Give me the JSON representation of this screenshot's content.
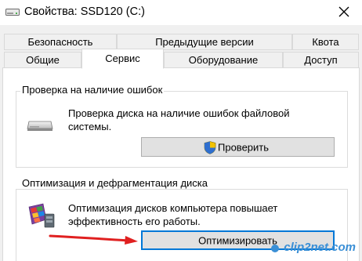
{
  "window": {
    "title": "Свойства: SSD120 (C:)",
    "title_icon": "drive-icon",
    "close_icon": "close-icon"
  },
  "tabs": {
    "row_top": [
      {
        "label": "Безопасность"
      },
      {
        "label": "Предыдущие версии"
      },
      {
        "label": "Квота"
      }
    ],
    "row_bottom": [
      {
        "label": "Общие"
      },
      {
        "label": "Сервис",
        "active": true
      },
      {
        "label": "Оборудование"
      },
      {
        "label": "Доступ"
      }
    ]
  },
  "error_check": {
    "title": "Проверка на наличие ошибок",
    "description_line1": "Проверка диска на наличие ошибок файловой",
    "description_line2": "системы.",
    "button_label": "Проверить",
    "button_icon": "uac-shield-icon"
  },
  "optimize": {
    "title": "Оптимизация и дефрагментация диска",
    "description_line1": "Оптимизация дисков компьютера повышает",
    "description_line2": "эффективность его работы.",
    "button_label": "Оптимизировать"
  },
  "watermark": {
    "text": "clip2net.com"
  },
  "colors": {
    "accent": "#0078d7",
    "arrow": "#e02020",
    "dialog_bg": "#f0f0f0",
    "panel_bg": "#ffffff"
  }
}
